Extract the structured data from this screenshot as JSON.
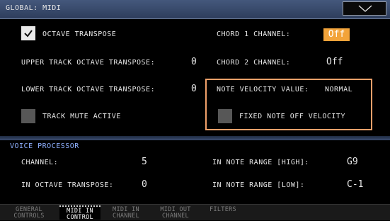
{
  "header": {
    "title": "GLOBAL: MIDI"
  },
  "global_midi": {
    "octave_transpose": {
      "label": "OCTAVE TRANSPOSE",
      "checked": true
    },
    "upper_track_octave_transpose": {
      "label": "UPPER TRACK OCTAVE TRANSPOSE:",
      "value": "0"
    },
    "lower_track_octave_transpose": {
      "label": "LOWER TRACK OCTAVE TRANSPOSE:",
      "value": "0"
    },
    "track_mute_active": {
      "label": "TRACK MUTE ACTIVE",
      "checked": false
    },
    "chord1_channel": {
      "label": "CHORD 1 CHANNEL:",
      "value": "Off"
    },
    "chord2_channel": {
      "label": "CHORD 2 CHANNEL:",
      "value": "Off"
    },
    "note_velocity": {
      "label": "NOTE VELOCITY VALUE:",
      "value": "NORMAL"
    },
    "fixed_note_off_velocity": {
      "label": "FIXED NOTE OFF VELOCITY",
      "checked": false
    }
  },
  "voice_processor": {
    "title": "VOICE PROCESSOR",
    "channel": {
      "label": "CHANNEL:",
      "value": "5"
    },
    "in_octave_transpose": {
      "label": "IN OCTAVE TRANSPOSE:",
      "value": "0"
    },
    "in_note_range_high": {
      "label": "IN NOTE RANGE [HIGH]:",
      "value": "G9"
    },
    "in_note_range_low": {
      "label": "IN NOTE RANGE [LOW]:",
      "value": "C-1"
    }
  },
  "tabs": [
    {
      "label": "GENERAL\nCONTROLS",
      "active": false
    },
    {
      "label": "MIDI IN\nCONTROL",
      "active": true
    },
    {
      "label": "MIDI IN\nCHANNEL",
      "active": false
    },
    {
      "label": "MIDI OUT\nCHANNEL",
      "active": false
    },
    {
      "label": "FILTERS",
      "active": false
    }
  ],
  "colors": {
    "header": "#3a4b6e",
    "accent_orange": "#f2a33a",
    "highlight_border": "#f0a06a",
    "section_title": "#8fb0ff"
  },
  "icons": {
    "dropdown": "chevron-down-icon",
    "check": "checkmark-icon"
  }
}
